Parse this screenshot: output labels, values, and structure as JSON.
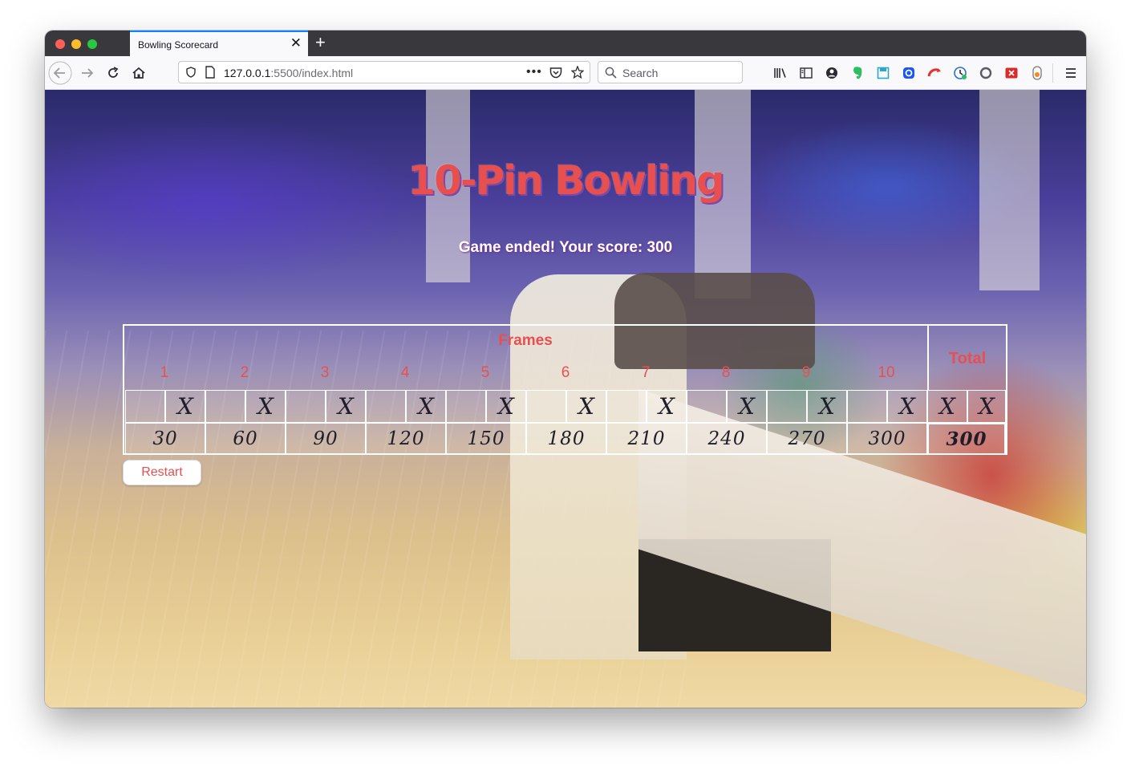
{
  "browser": {
    "tab_title": "Bowling Scorecard",
    "url_host": "127.0.0.1",
    "url_rest": ":5500/index.html",
    "search_placeholder": "Search",
    "icons": [
      "back-icon",
      "forward-icon",
      "reload-icon",
      "home-icon",
      "shield-icon",
      "page-icon",
      "more-icon",
      "pocket-icon",
      "star-icon",
      "search-icon",
      "library-icon",
      "sidebar-icon",
      "account-icon",
      "evernote-icon",
      "save-icon",
      "extension-blue-icon",
      "extension-red-icon",
      "extension-monitor-icon",
      "extension-circle-icon",
      "extension-x-icon",
      "extension-orange-icon",
      "menu-icon"
    ]
  },
  "page": {
    "heading": "10-Pin Bowling",
    "message": "Game ended! Your score: 300",
    "restart_label": "Restart",
    "accent_color": "#e8504f"
  },
  "scorecard": {
    "frames_title": "Frames",
    "total_title": "Total",
    "frame_numbers": [
      "1",
      "2",
      "3",
      "4",
      "5",
      "6",
      "7",
      "8",
      "9",
      "10"
    ],
    "frames": [
      {
        "rolls": [
          "",
          "X"
        ],
        "score": "30"
      },
      {
        "rolls": [
          "",
          "X"
        ],
        "score": "60"
      },
      {
        "rolls": [
          "",
          "X"
        ],
        "score": "90"
      },
      {
        "rolls": [
          "",
          "X"
        ],
        "score": "120"
      },
      {
        "rolls": [
          "",
          "X"
        ],
        "score": "150"
      },
      {
        "rolls": [
          "",
          "X"
        ],
        "score": "180"
      },
      {
        "rolls": [
          "",
          "X"
        ],
        "score": "210"
      },
      {
        "rolls": [
          "",
          "X"
        ],
        "score": "240"
      },
      {
        "rolls": [
          "",
          "X"
        ],
        "score": "270"
      },
      {
        "rolls": [
          "",
          "X"
        ],
        "score": "300"
      }
    ],
    "bonus_rolls": [
      "X",
      "X"
    ],
    "total_score": "300"
  }
}
